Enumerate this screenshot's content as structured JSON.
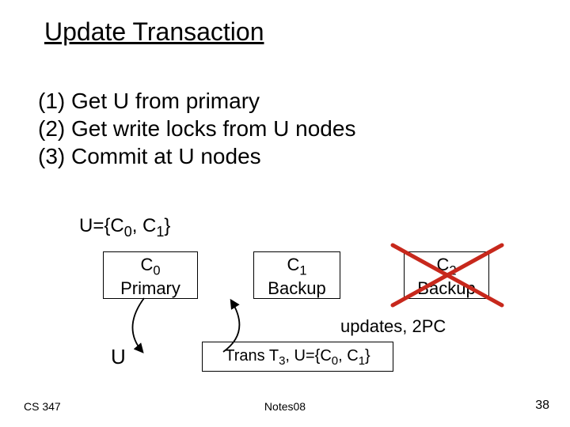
{
  "title": "Update Transaction",
  "steps": {
    "s1": "(1) Get U from primary",
    "s2": "(2) Get write locks from U nodes",
    "s3": "(3) Commit at U nodes"
  },
  "uset_prefix": "U={C",
  "uset_sub0": "0",
  "uset_mid": ", C",
  "uset_sub1": "1",
  "uset_suffix": "}",
  "nodes": {
    "c0": {
      "name_prefix": "C",
      "name_sub": "0",
      "role": "Primary"
    },
    "c1": {
      "name_prefix": "C",
      "name_sub": "1",
      "role": "Backup"
    },
    "c2": {
      "name_prefix": "C",
      "name_sub": "2",
      "role": "Backup"
    }
  },
  "cross_color": "#c7281c",
  "updates_label": "updates, 2PC",
  "u_label": "U",
  "trans_prefix": "Trans T",
  "trans_sub": "3",
  "trans_mid": ", U={C",
  "trans_sub0": "0",
  "trans_mid2": ", C",
  "trans_sub1": "1",
  "trans_suffix": "}",
  "footer": {
    "left": "CS 347",
    "center": "Notes08",
    "right": "38"
  }
}
